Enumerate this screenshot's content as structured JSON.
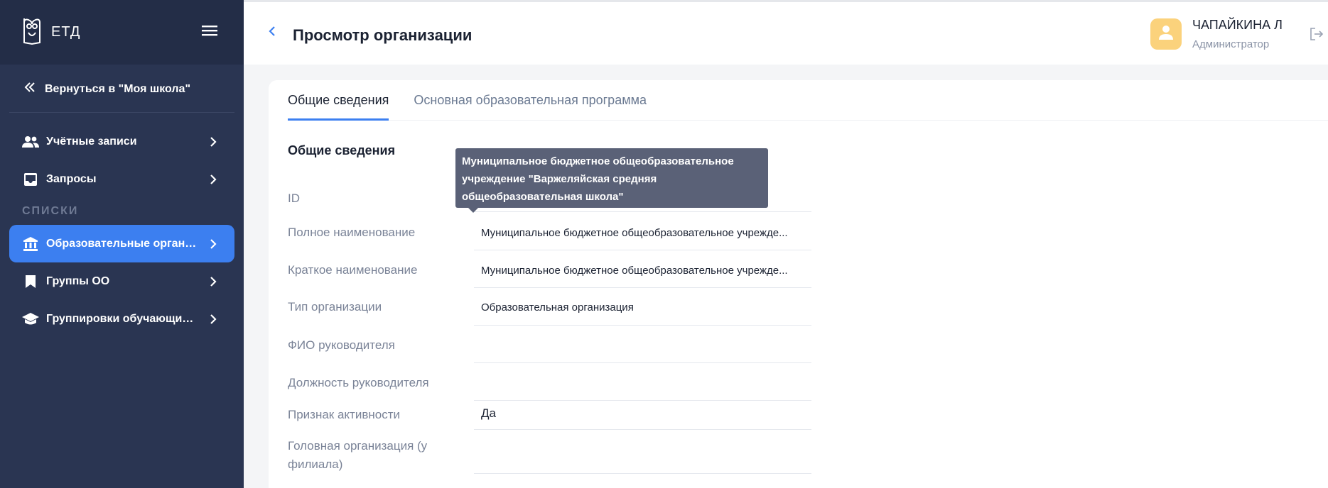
{
  "app": {
    "logo_text": "ЕТД"
  },
  "sidebar": {
    "back_link": "Вернуться в \"Моя школа\"",
    "items_top": [
      {
        "label": "Учётные записи",
        "icon": "users-icon"
      },
      {
        "label": "Запросы",
        "icon": "inbox-icon"
      }
    ],
    "section_title": "СПИСКИ",
    "items_lists": [
      {
        "label": "Образовательные организа...",
        "icon": "institution-icon",
        "active": true
      },
      {
        "label": "Группы ОО",
        "icon": "bookmark-icon"
      },
      {
        "label": "Группировки обучающихся",
        "icon": "school-cap-icon"
      }
    ]
  },
  "header": {
    "title": "Просмотр организации",
    "user_name": "ЧАПАЙКИНА Л",
    "user_role": "Администратор"
  },
  "tabs": [
    {
      "label": "Общие сведения",
      "active": true
    },
    {
      "label": "Основная образовательная программа",
      "active": false
    }
  ],
  "section_heading": "Общие сведения",
  "fields": [
    {
      "label": "ID",
      "value": ""
    },
    {
      "label": "Полное наименование",
      "value": "Муниципальное бюджетное общеобразовательное учрежде..."
    },
    {
      "label": "Краткое наименование",
      "value": "Муниципальное бюджетное общеобразовательное учрежде..."
    },
    {
      "label": "Тип организации",
      "value": "Образовательная организация"
    },
    {
      "label": "ФИО руководителя",
      "value": ""
    },
    {
      "label": "Должность руководителя",
      "value": ""
    },
    {
      "label": "Признак активности",
      "value": "Да"
    },
    {
      "label": "Головная организация (у филиала)",
      "value": ""
    }
  ],
  "tooltip": "Муниципальное бюджетное общеобразовательное учреждение \"Варжеляйская средняя общеобразовательная школа\"",
  "colors": {
    "sidebar": "#2a3552",
    "accent": "#3c7ff0",
    "avatar": "#fbd27c"
  }
}
